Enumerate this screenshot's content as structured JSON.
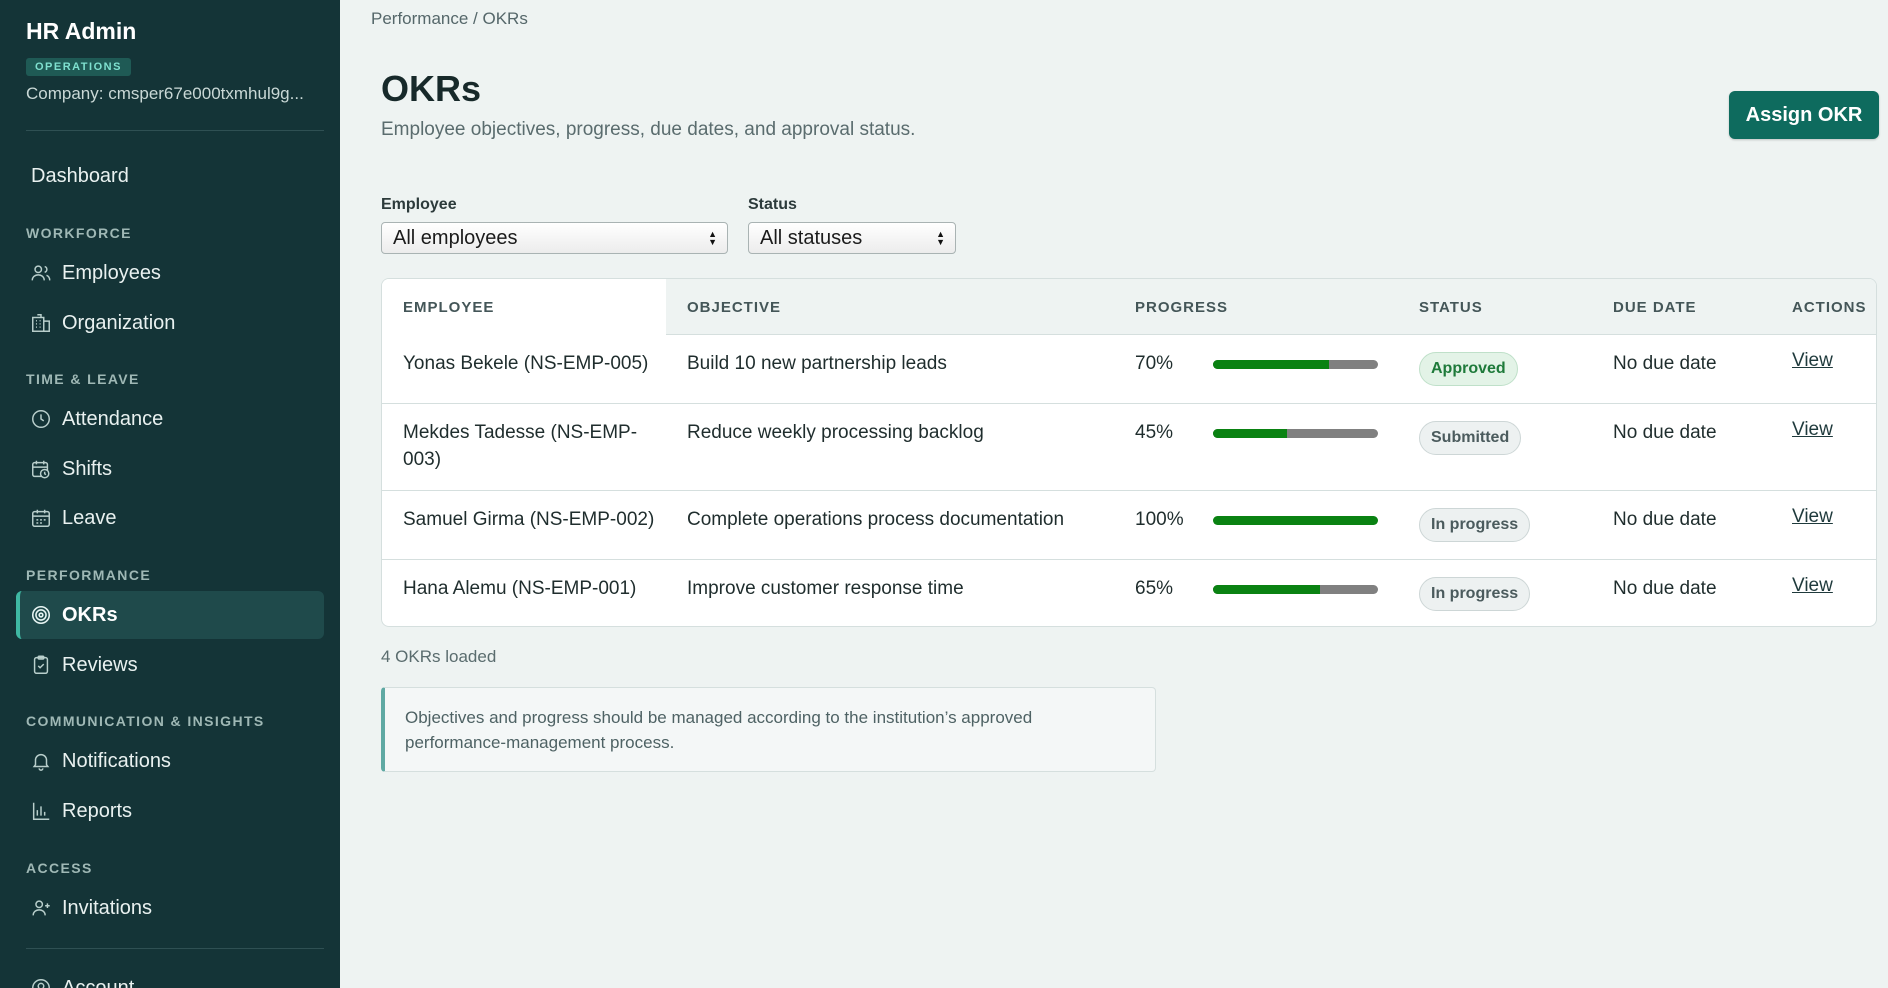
{
  "sidebar": {
    "app_title": "HR Admin",
    "badge": "OPERATIONS",
    "company": "Company: cmsper67e000txmhul9g...",
    "dashboard": "Dashboard",
    "sections": {
      "workforce": "WORKFORCE",
      "time_leave": "TIME & LEAVE",
      "performance": "PERFORMANCE",
      "communication": "COMMUNICATION & INSIGHTS",
      "access": "ACCESS"
    },
    "items": {
      "employees": "Employees",
      "organization": "Organization",
      "attendance": "Attendance",
      "shifts": "Shifts",
      "leave": "Leave",
      "okrs": "OKRs",
      "reviews": "Reviews",
      "notifications": "Notifications",
      "reports": "Reports",
      "invitations": "Invitations",
      "account": "Account"
    }
  },
  "header": {
    "breadcrumb": "Performance / OKRs",
    "title": "OKRs",
    "subtitle": "Employee objectives, progress, due dates, and approval status.",
    "assign_button": "Assign OKR"
  },
  "filters": {
    "employee_label": "Employee",
    "employee_value": "All employees",
    "status_label": "Status",
    "status_value": "All statuses"
  },
  "table": {
    "columns": [
      "EMPLOYEE",
      "OBJECTIVE",
      "PROGRESS",
      "STATUS",
      "DUE DATE",
      "ACTIONS"
    ],
    "rows": [
      {
        "employee": "Yonas Bekele (NS-EMP-005)",
        "objective": "Build 10 new partnership leads",
        "progress_label": "70%",
        "progress": 0.7,
        "status": "Approved",
        "due": "No due date",
        "action": "View"
      },
      {
        "employee_line1": "Mekdes Tadesse (NS-EMP-",
        "employee_line2": "003)",
        "objective": "Reduce weekly processing backlog",
        "progress_label": "45%",
        "progress": 0.45,
        "status": "Submitted",
        "due": "No due date",
        "action": "View"
      },
      {
        "employee": "Samuel Girma (NS-EMP-002)",
        "objective": "Complete operations process documentation",
        "progress_label": "100%",
        "progress": 1.0,
        "status": "In progress",
        "due": "No due date",
        "action": "View"
      },
      {
        "employee": "Hana Alemu (NS-EMP-001)",
        "objective": "Improve customer response time",
        "progress_label": "65%",
        "progress": 0.65,
        "status": "In progress",
        "due": "No due date",
        "action": "View"
      }
    ]
  },
  "footer": {
    "count": "4 OKRs loaded",
    "notice": "Objectives and progress should be managed according to the institution’s approved performance-management process."
  },
  "colors": {
    "sidebar_bg": "#143437",
    "accent": "#0e6b5e",
    "progress_fill": "#0a8212",
    "progress_track": "#808080"
  },
  "icons": {
    "employees": "users-icon",
    "organization": "building-icon",
    "attendance": "clock-icon",
    "shifts": "calendar-clock-icon",
    "leave": "calendar-icon",
    "okrs": "target-icon",
    "reviews": "clipboard-check-icon",
    "notifications": "bell-icon",
    "reports": "bar-chart-icon",
    "invitations": "user-plus-icon",
    "account": "account-icon"
  }
}
